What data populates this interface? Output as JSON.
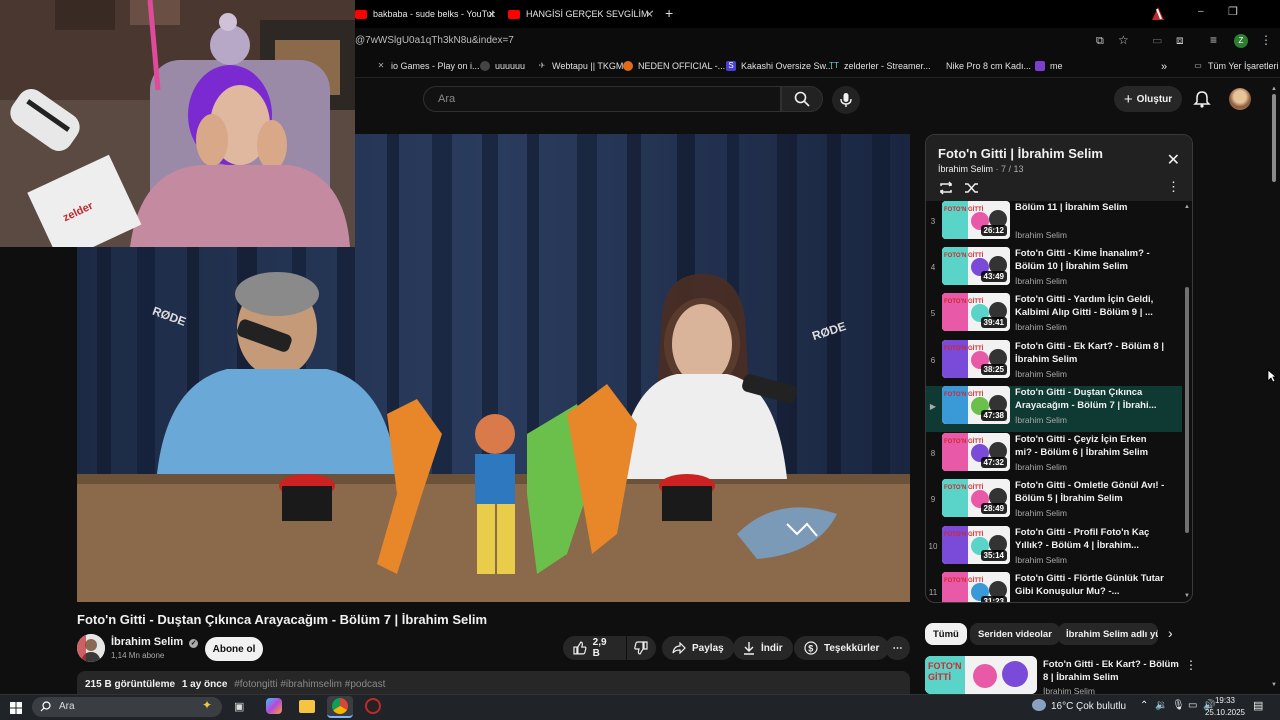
{
  "browser": {
    "tabs": [
      {
        "label": "bakbaba - sude belks - YouTube"
      },
      {
        "label": "HANGİSİ GERÇEK SEVGİLİM ? | "
      }
    ],
    "url": "@7wWSlgU0a1qTh3kN8u&index=7",
    "bookmarks": [
      "io Games - Play on i...",
      "uuuuuu",
      "Webtapu || TKGM",
      "NEDEN OFFICIAL -...",
      "Kakashi Oversize Sw...",
      "zelderler - Streamer...",
      "Nike Pro 8 cm Kadı...",
      "me",
      "Tüm Yer İşaretleri"
    ],
    "profile_initial": "Z"
  },
  "header": {
    "search_placeholder": "Ara",
    "create_label": "Oluştur"
  },
  "webcam": {
    "sign_text": "zelder"
  },
  "video": {
    "title": "Foto'n Gitti - Duştan Çıkınca Arayacağım - Bölüm 7 | İbrahim Selim",
    "channel": "İbrahim Selim",
    "subscribers": "1,14 Mn abone",
    "subscribe_label": "Abone ol",
    "likes": "2,9 B",
    "share_label": "Paylaş",
    "download_label": "İndir",
    "thanks_label": "Teşekkürler",
    "views": "215 B görüntüleme",
    "age": "1 ay önce",
    "hashtags": "#fotongitti #ibrahimselim #podcast",
    "mic_brand": "RØDE"
  },
  "playlist": {
    "title": "Foto'n Gitti | İbrahim Selim",
    "channel": "İbrahim Selim",
    "position": "7 / 13",
    "items": [
      {
        "idx": "3",
        "title": "Bölüm 11 | İbrahim Selim",
        "channel": "İbrahim Selim",
        "duration": "26:12"
      },
      {
        "idx": "4",
        "title": "Foto'n Gitti - Kime İnanalım? - Bölüm 10 | İbrahim Selim",
        "channel": "İbrahim Selim",
        "duration": "43:49"
      },
      {
        "idx": "5",
        "title": "Foto'n Gitti - Yardım İçin Geldi, Kalbimi Alıp Gitti - Bölüm 9 | ...",
        "channel": "İbrahim Selim",
        "duration": "39:41"
      },
      {
        "idx": "6",
        "title": "Foto'n Gitti - Ek Kart? - Bölüm 8 | İbrahim Selim",
        "channel": "İbrahim Selim",
        "duration": "38:25"
      },
      {
        "idx": "▶",
        "title": "Foto'n Gitti - Duştan Çıkınca Arayacağım - Bölüm 7 | İbrahi...",
        "channel": "İbrahim Selim",
        "duration": "47:38"
      },
      {
        "idx": "8",
        "title": "Foto'n Gitti - Çeyiz İçin Erken mi? - Bölüm 6 | İbrahim Selim",
        "channel": "İbrahim Selim",
        "duration": "47:32"
      },
      {
        "idx": "9",
        "title": "Foto'n Gitti - Omletle Gönül Avı! - Bölüm 5 | İbrahim Selim",
        "channel": "İbrahim Selim",
        "duration": "28:49"
      },
      {
        "idx": "10",
        "title": "Foto'n Gitti - Profil Foto'n Kaç Yıllık? - Bölüm 4 | İbrahim...",
        "channel": "İbrahim Selim",
        "duration": "35:14"
      },
      {
        "idx": "11",
        "title": "Foto'n Gitti - Flörtle Günlük Tutar Gibi Konuşulur Mu? -...",
        "channel": "İbrahim Selim",
        "duration": "31:23"
      }
    ],
    "thumb_text": "FOTO'N GİTTİ"
  },
  "chips": [
    "Tümü",
    "Seriden videolar",
    "İbrahim Selim adlı yükleyici"
  ],
  "recommended": {
    "title": "Foto'n Gitti - Ek Kart? - Bölüm 8 | İbrahim Selim",
    "channel": "İbrahim Selim"
  },
  "taskbar": {
    "search_label": "Ara",
    "weather": "16°C",
    "weather_desc": "Çok bulutlu",
    "time": "19:33",
    "date": "25.10.2025"
  }
}
